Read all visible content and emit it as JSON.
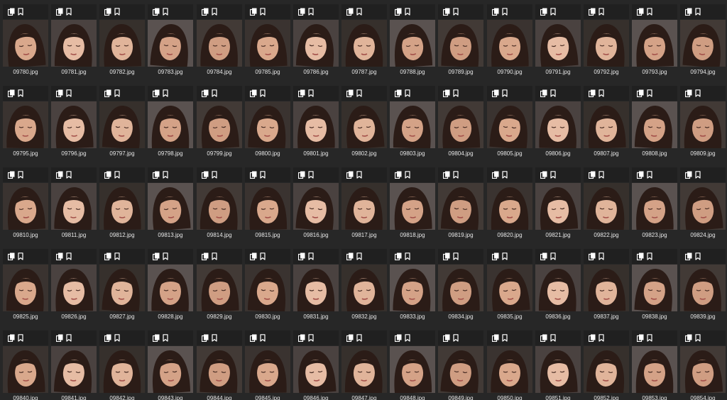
{
  "grid": {
    "columns": 15,
    "rows": 5,
    "tile_icons": [
      "copy-icon",
      "bookmark-icon"
    ],
    "files": [
      "09780.jpg",
      "09781.jpg",
      "09782.jpg",
      "09783.jpg",
      "09784.jpg",
      "09785.jpg",
      "09786.jpg",
      "09787.jpg",
      "09788.jpg",
      "09789.jpg",
      "09790.jpg",
      "09791.jpg",
      "09792.jpg",
      "09793.jpg",
      "09794.jpg",
      "09795.jpg",
      "09796.jpg",
      "09797.jpg",
      "09798.jpg",
      "09799.jpg",
      "09800.jpg",
      "09801.jpg",
      "09802.jpg",
      "09803.jpg",
      "09804.jpg",
      "09805.jpg",
      "09806.jpg",
      "09807.jpg",
      "09808.jpg",
      "09809.jpg",
      "09810.jpg",
      "09811.jpg",
      "09812.jpg",
      "09813.jpg",
      "09814.jpg",
      "09815.jpg",
      "09816.jpg",
      "09817.jpg",
      "09818.jpg",
      "09819.jpg",
      "09820.jpg",
      "09821.jpg",
      "09822.jpg",
      "09823.jpg",
      "09824.jpg",
      "09825.jpg",
      "09826.jpg",
      "09827.jpg",
      "09828.jpg",
      "09829.jpg",
      "09830.jpg",
      "09831.jpg",
      "09832.jpg",
      "09833.jpg",
      "09834.jpg",
      "09835.jpg",
      "09836.jpg",
      "09837.jpg",
      "09838.jpg",
      "09839.jpg",
      "09840.jpg",
      "09841.jpg",
      "09842.jpg",
      "09843.jpg",
      "09844.jpg",
      "09845.jpg",
      "09846.jpg",
      "09847.jpg",
      "09848.jpg",
      "09849.jpg",
      "09850.jpg",
      "09851.jpg",
      "09852.jpg",
      "09853.jpg",
      "09854.jpg"
    ]
  },
  "colors": {
    "background": "#272727",
    "tile_header": "#202020",
    "icon": "#ffffff",
    "filename_text": "#e6e6e6",
    "hair": "#2b1c17",
    "skin": "#d9a88c"
  }
}
